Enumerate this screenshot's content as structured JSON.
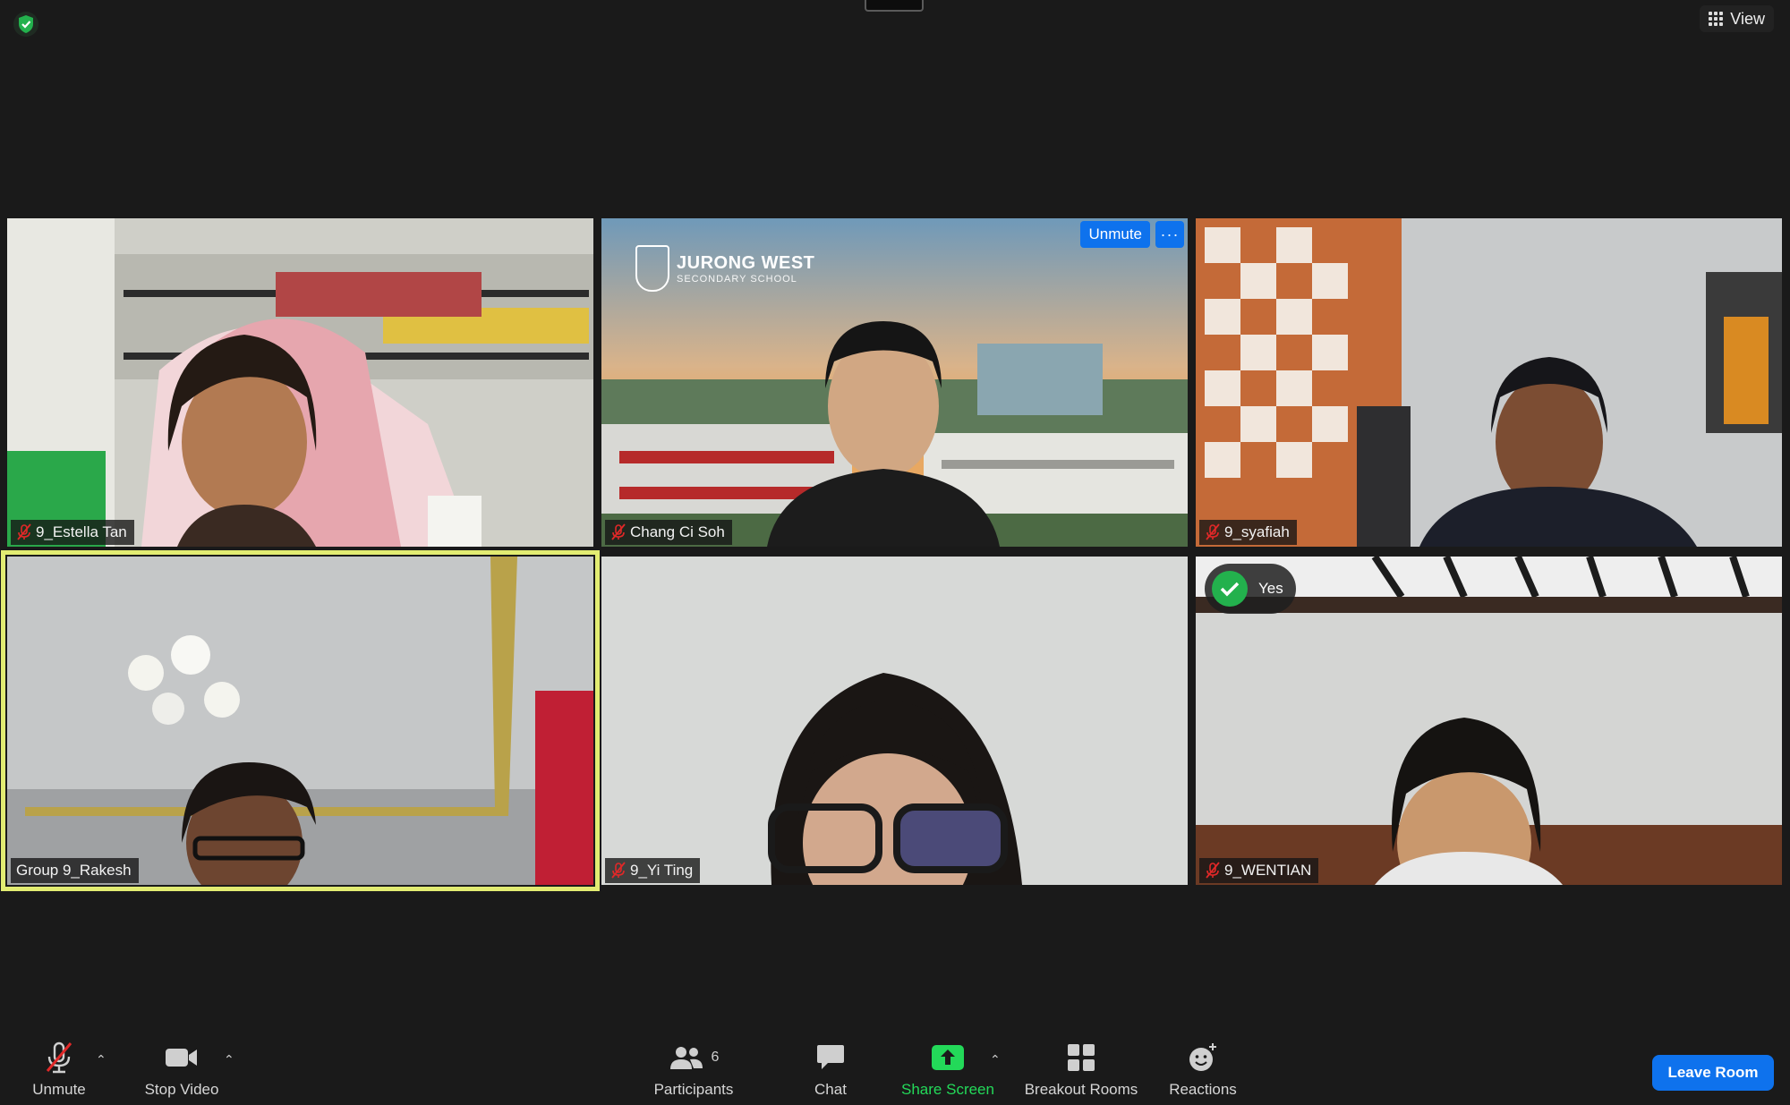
{
  "top": {
    "view_label": "View"
  },
  "tiles": [
    {
      "name": "9_Estella Tan",
      "muted": true
    },
    {
      "name": "Chang Ci Soh",
      "muted": true,
      "unmute_label": "Unmute",
      "more_label": "···"
    },
    {
      "name": "9_syafiah",
      "muted": true
    },
    {
      "name": "Group 9_Rakesh",
      "muted": false,
      "active_speaker": true
    },
    {
      "name": "9_Yi Ting",
      "muted": true
    },
    {
      "name": "9_WENTIAN",
      "muted": true,
      "reaction_label": "Yes"
    }
  ],
  "background_logo": {
    "line1": "JURONG WEST",
    "line2": "SECONDARY SCHOOL"
  },
  "toolbar": {
    "unmute": "Unmute",
    "stop_video": "Stop Video",
    "participants": "Participants",
    "participants_count": "6",
    "chat": "Chat",
    "share_screen": "Share Screen",
    "breakout_rooms": "Breakout Rooms",
    "reactions": "Reactions",
    "leave_room": "Leave Room"
  },
  "colors": {
    "background": "#1a1a1a",
    "accent_blue": "#0e72ed",
    "share_green": "#23d959",
    "active_speaker": "#e2ec72",
    "mute_red": "#e02828"
  }
}
